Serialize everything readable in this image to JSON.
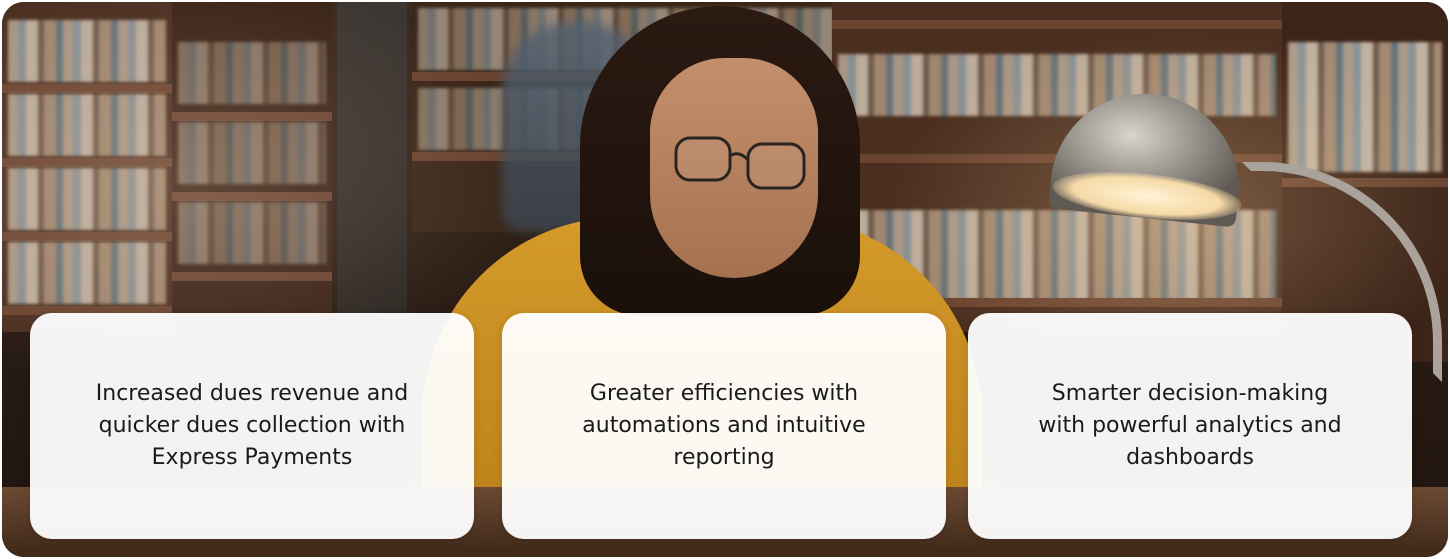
{
  "hero": {
    "image_subject": "woman-studying-in-library",
    "cards": [
      {
        "text": "Increased dues revenue and quicker dues collection with Express Payments"
      },
      {
        "text": "Greater efficiencies with automations and intuitive reporting"
      },
      {
        "text": "Smarter decision-making with powerful analytics and dashboards"
      }
    ]
  },
  "colors": {
    "card_background": "#ffffff",
    "card_text": "#1a1a1a"
  }
}
